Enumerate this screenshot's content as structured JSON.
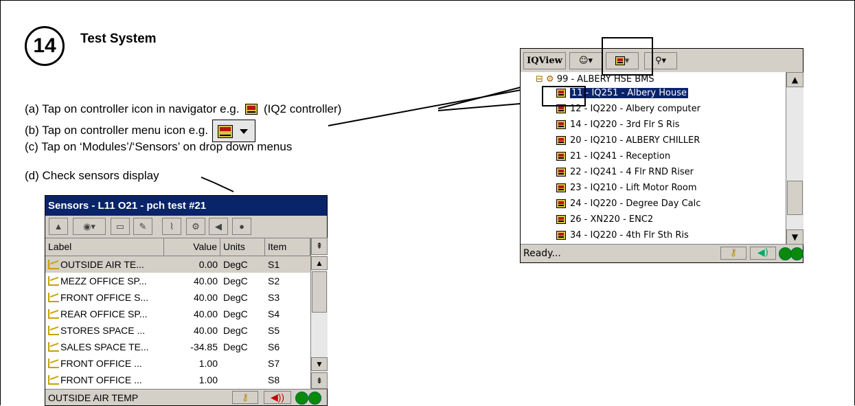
{
  "step": {
    "number": "14",
    "title": "Test System"
  },
  "instructions": {
    "a_pre": "(a) Tap on  controller icon in navigator e.g.",
    "a_post": "(IQ2 controller)",
    "b": "(b) Tap on controller menu icon e.g.",
    "c": "(c) Tap on ‘Modules’/‘Sensors’ on drop down menus",
    "d": "(d) Check sensors display"
  },
  "sensors_window": {
    "title": "Sensors - L11 O21 -  pch test #21",
    "columns": [
      "Label",
      "Value",
      "Units",
      "Item"
    ],
    "rows": [
      {
        "label": "OUTSIDE AIR TE...",
        "value": "0.00",
        "units": "DegC",
        "item": "S1"
      },
      {
        "label": "MEZZ OFFICE SP...",
        "value": "40.00",
        "units": "DegC",
        "item": "S2"
      },
      {
        "label": "FRONT OFFICE S...",
        "value": "40.00",
        "units": "DegC",
        "item": "S3"
      },
      {
        "label": "REAR OFFICE SP...",
        "value": "40.00",
        "units": "DegC",
        "item": "S4"
      },
      {
        "label": "STORES SPACE ...",
        "value": "40.00",
        "units": "DegC",
        "item": "S5"
      },
      {
        "label": "SALES SPACE TE...",
        "value": "-34.85",
        "units": "DegC",
        "item": "S6"
      },
      {
        "label": "FRONT OFFICE ...",
        "value": "1.00",
        "units": "",
        "item": "S7"
      },
      {
        "label": "FRONT OFFICE ...",
        "value": "1.00",
        "units": "",
        "item": "S8"
      }
    ],
    "status": "OUTSIDE AIR TEMP"
  },
  "navigator": {
    "toolbar_label": "IQView",
    "root": "99 - ALBERY HSE BMS",
    "items": [
      "11 - IQ251 - Albery House",
      "12 - IQ220 - Albery computer",
      "14 - IQ220 - 3rd Flr S Ris",
      "20 - IQ210 -  ALBERY CHILLER",
      "21 - IQ241 - Reception",
      "22 - IQ241 - 4 Flr RND Riser",
      "23 - IQ210 - Lift Motor Room",
      "24 - IQ220 - Degree Day Calc",
      "26 - XN220 - ENC2",
      "34 - IQ220 - 4th Flr Sth Ris"
    ],
    "status": "Ready..."
  },
  "icons": [
    "controller-icon",
    "menu-arrow-icon",
    "binoculars-icon",
    "key-icon",
    "speaker-icon",
    "status-led-icon",
    "trend-icon"
  ]
}
